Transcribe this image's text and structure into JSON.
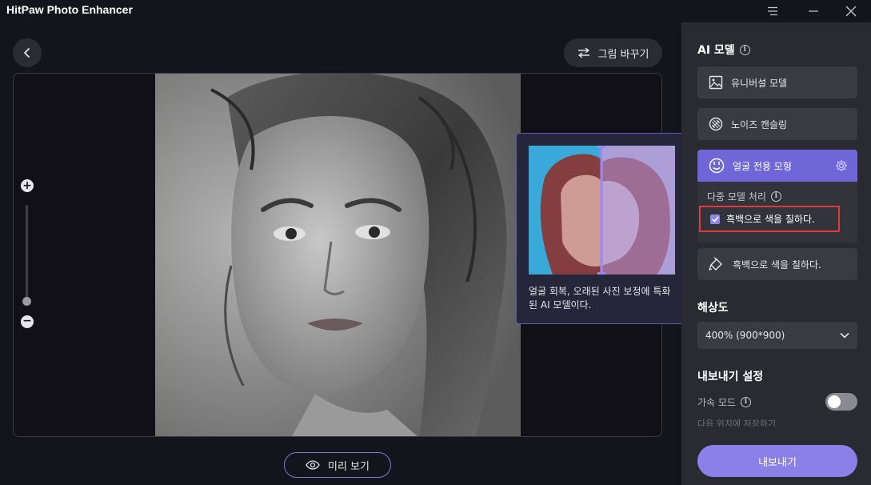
{
  "app": {
    "title": "HitPaw Photo Enhancer"
  },
  "window_controls": {
    "menu_icon": "hamburger-icon",
    "minimize_icon": "minimize-icon",
    "close_icon": "close-icon"
  },
  "canvas": {
    "back_icon": "chevron-left-icon",
    "swap_button_label": "그림 바꾸기",
    "swap_icon": "swap-arrows-icon",
    "preview_button_label": "미리 보기",
    "preview_icon": "eye-icon",
    "zoom": {
      "in_label": "+",
      "out_label": "−",
      "level_fraction": 0.1
    }
  },
  "tooltip": {
    "description": "얼굴 회복, 오래된 사진 보정에 특화된 AI 모델이다."
  },
  "side_panel": {
    "ai_model_title": "AI 모델",
    "models": [
      {
        "label": "유니버설 모델",
        "icon": "image-icon",
        "active": false
      },
      {
        "label": "노이즈 캔슬링",
        "icon": "noise-icon",
        "active": false
      },
      {
        "label": "얼굴 전용 모형",
        "icon": "face-icon",
        "active": true
      }
    ],
    "active_settings_icon": "gear-icon",
    "multi_model_label": "다중 모델 처리",
    "colorize_checkbox_label": "흑백으로 색을 칠하다.",
    "colorize_checked": true,
    "colorize_model_label": "흑백으로 색을 칠하다.",
    "colorize_model_icon": "paint-bucket-icon",
    "resolution_title": "해상도",
    "resolution_value": "400% (900*900)",
    "export_settings_title": "내보내기 설정",
    "acceleration_label": "가속 모드",
    "acceleration_on": false,
    "save_location_label": "다음 위치에 저장하기",
    "export_button_label": "내보내기"
  },
  "colors": {
    "accent": "#8a80e8",
    "active_card": "#6f66d8",
    "highlight_border": "#e03a3a",
    "panel_bg": "#2a2a32",
    "app_bg": "#14141c"
  }
}
